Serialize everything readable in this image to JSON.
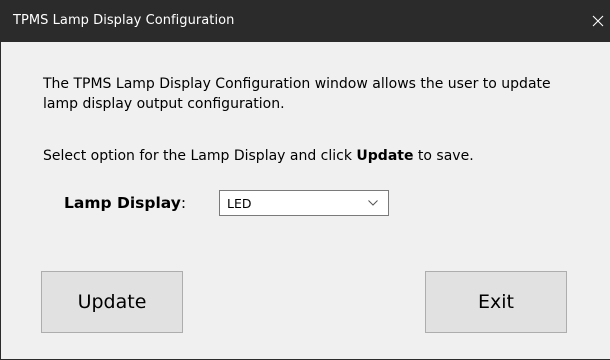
{
  "window": {
    "title": "TPMS Lamp Display Configuration",
    "close_glyph": "✕"
  },
  "content": {
    "description": "The TPMS Lamp Display Configuration window allows the user to update lamp display output configuration.",
    "instruction_prefix": "Select option for the Lamp Display and click ",
    "instruction_bold": "Update",
    "instruction_suffix": " to save."
  },
  "lamp_display": {
    "label": "Lamp Display",
    "colon": ":",
    "selected_value": "LED",
    "dropdown_icon": "chevron-down-icon"
  },
  "buttons": {
    "update_label": "Update",
    "exit_label": "Exit"
  },
  "colors": {
    "titlebar": "#2b2b2b",
    "window_background": "#f0f0f0",
    "button_background": "#e1e1e1",
    "button_border": "#adadad"
  }
}
